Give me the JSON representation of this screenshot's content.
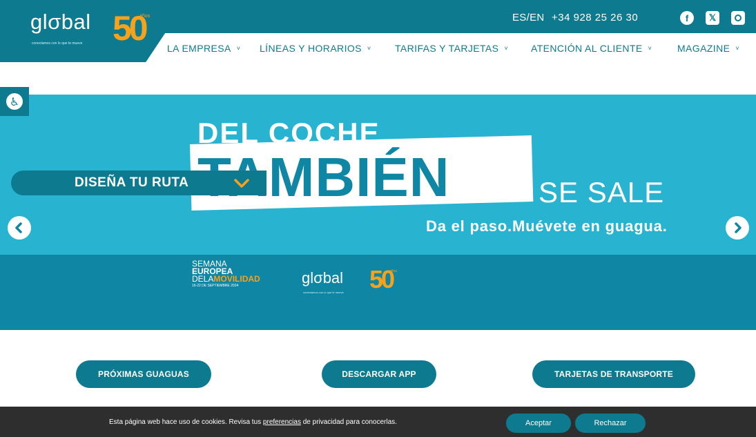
{
  "header": {
    "logo": {
      "wordmark": "glσbal",
      "tagline": "conectamos con lo que te mueve",
      "anniversary_number": "50",
      "anniversary_word": "años"
    },
    "language": "ES/EN",
    "phone": "+34 928 25 26 30",
    "social": [
      {
        "name": "facebook-icon",
        "glyph": "f"
      },
      {
        "name": "x-icon",
        "glyph": "𝕏"
      },
      {
        "name": "instagram-icon",
        "glyph": ""
      }
    ],
    "nav": [
      {
        "label": "LA EMPRESA"
      },
      {
        "label": "LÍNEAS Y HORARIOS"
      },
      {
        "label": "TARIFAS Y TARJETAS"
      },
      {
        "label": "ATENCIÓN AL CLIENTE"
      },
      {
        "label": "MAGAZINE"
      }
    ],
    "nav_chevron": "˅"
  },
  "accessibility": {
    "icon": "accessibility-icon",
    "glyph": "♿"
  },
  "hero": {
    "line1": "DEL COCHE",
    "line2": "TAMBIÉN",
    "line3": "SE SALE",
    "slogan": "Da el paso.Muévete en guagua.",
    "semana": {
      "line1": "SEMANA",
      "line2": "EUROPEA",
      "line3a": "DELA",
      "line3b": "MOVILIDAD",
      "dates": "16-22 DE SEPTIEMBRE 2024"
    },
    "logo": {
      "wordmark": "glσbal",
      "tagline": "conectamos con lo que te mueve",
      "anniversary_number": "50",
      "anniversary_word": "años"
    }
  },
  "route_planner": {
    "label": "DISEÑA TU RUTA"
  },
  "carousel": {
    "prev_icon": "chevron-left-icon",
    "next_icon": "chevron-right-icon"
  },
  "buttons": {
    "next_buses": "PRÓXIMAS GUAGUAS",
    "download_app": "DESCARGAR APP",
    "transport_cards": "TARJETAS DE TRANSPORTE"
  },
  "cookie_bar": {
    "text_before": "Esta página web hace uso de cookies. Revisa tus ",
    "link": "preferencias",
    "text_after": " de privacidad para conocerlas.",
    "accept": "Aceptar",
    "reject": "Rechazar"
  },
  "colors": {
    "brand_teal": "#0e7a8f",
    "hero_light": "#28b3d1",
    "hero_dark": "#0f86a4",
    "accent_orange": "#f6a21c",
    "cookie_bg": "#2e2e2e"
  }
}
